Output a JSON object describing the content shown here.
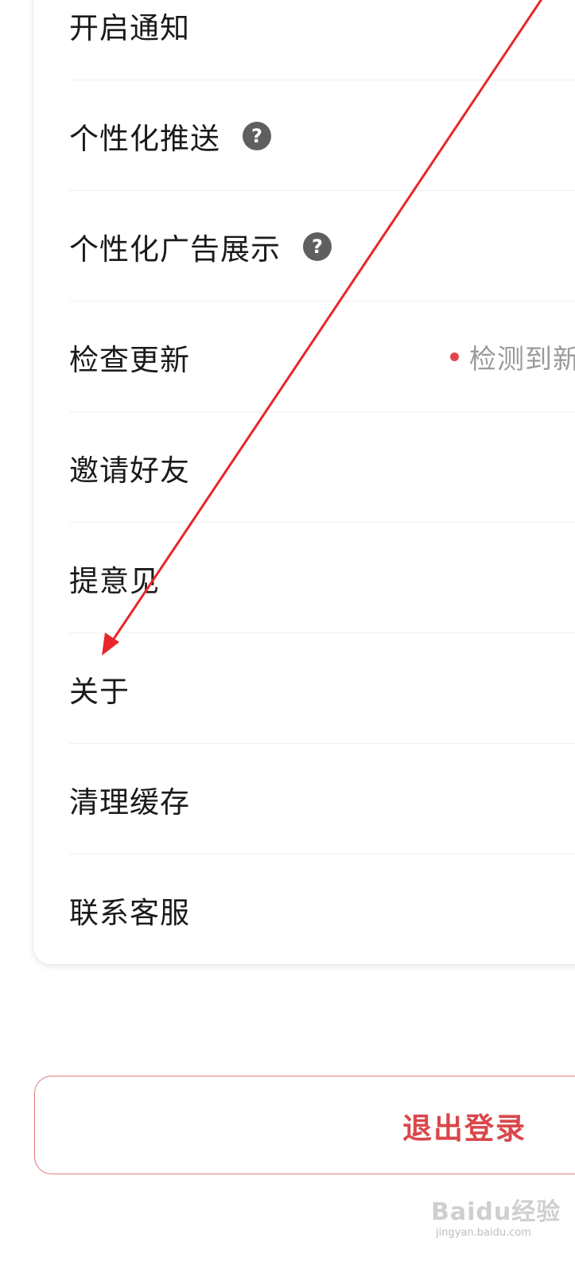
{
  "settings": {
    "items": [
      {
        "label": "开启通知"
      },
      {
        "label": "个性化推送"
      },
      {
        "label": "个性化广告展示"
      },
      {
        "label": "检查更新",
        "status": "检测到新"
      },
      {
        "label": "邀请好友"
      },
      {
        "label": "提意见"
      },
      {
        "label": "关于"
      },
      {
        "label": "清理缓存"
      },
      {
        "label": "联系客服"
      }
    ],
    "help_symbol": "?"
  },
  "logout": {
    "label": "退出登录"
  },
  "annotation": {
    "type": "red-arrow",
    "color": "#e8262b",
    "points_to": "关于"
  },
  "watermark": {
    "brand": "Baidu经验",
    "url": "jingyan.baidu.com"
  },
  "colors": {
    "accent": "#d9474b",
    "status_dot": "#e0454a",
    "help_icon_bg": "#5f5f5f"
  }
}
